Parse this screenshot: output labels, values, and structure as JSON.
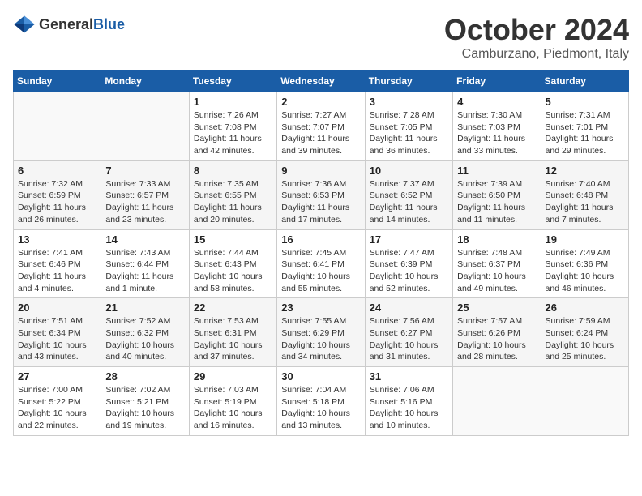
{
  "header": {
    "logo": {
      "general": "General",
      "blue": "Blue"
    },
    "title": "October 2024",
    "location": "Camburzano, Piedmont, Italy"
  },
  "calendar": {
    "days_of_week": [
      "Sunday",
      "Monday",
      "Tuesday",
      "Wednesday",
      "Thursday",
      "Friday",
      "Saturday"
    ],
    "weeks": [
      [
        {
          "day": "",
          "info": ""
        },
        {
          "day": "",
          "info": ""
        },
        {
          "day": "1",
          "info": "Sunrise: 7:26 AM\nSunset: 7:08 PM\nDaylight: 11 hours and 42 minutes."
        },
        {
          "day": "2",
          "info": "Sunrise: 7:27 AM\nSunset: 7:07 PM\nDaylight: 11 hours and 39 minutes."
        },
        {
          "day": "3",
          "info": "Sunrise: 7:28 AM\nSunset: 7:05 PM\nDaylight: 11 hours and 36 minutes."
        },
        {
          "day": "4",
          "info": "Sunrise: 7:30 AM\nSunset: 7:03 PM\nDaylight: 11 hours and 33 minutes."
        },
        {
          "day": "5",
          "info": "Sunrise: 7:31 AM\nSunset: 7:01 PM\nDaylight: 11 hours and 29 minutes."
        }
      ],
      [
        {
          "day": "6",
          "info": "Sunrise: 7:32 AM\nSunset: 6:59 PM\nDaylight: 11 hours and 26 minutes."
        },
        {
          "day": "7",
          "info": "Sunrise: 7:33 AM\nSunset: 6:57 PM\nDaylight: 11 hours and 23 minutes."
        },
        {
          "day": "8",
          "info": "Sunrise: 7:35 AM\nSunset: 6:55 PM\nDaylight: 11 hours and 20 minutes."
        },
        {
          "day": "9",
          "info": "Sunrise: 7:36 AM\nSunset: 6:53 PM\nDaylight: 11 hours and 17 minutes."
        },
        {
          "day": "10",
          "info": "Sunrise: 7:37 AM\nSunset: 6:52 PM\nDaylight: 11 hours and 14 minutes."
        },
        {
          "day": "11",
          "info": "Sunrise: 7:39 AM\nSunset: 6:50 PM\nDaylight: 11 hours and 11 minutes."
        },
        {
          "day": "12",
          "info": "Sunrise: 7:40 AM\nSunset: 6:48 PM\nDaylight: 11 hours and 7 minutes."
        }
      ],
      [
        {
          "day": "13",
          "info": "Sunrise: 7:41 AM\nSunset: 6:46 PM\nDaylight: 11 hours and 4 minutes."
        },
        {
          "day": "14",
          "info": "Sunrise: 7:43 AM\nSunset: 6:44 PM\nDaylight: 11 hours and 1 minute."
        },
        {
          "day": "15",
          "info": "Sunrise: 7:44 AM\nSunset: 6:43 PM\nDaylight: 10 hours and 58 minutes."
        },
        {
          "day": "16",
          "info": "Sunrise: 7:45 AM\nSunset: 6:41 PM\nDaylight: 10 hours and 55 minutes."
        },
        {
          "day": "17",
          "info": "Sunrise: 7:47 AM\nSunset: 6:39 PM\nDaylight: 10 hours and 52 minutes."
        },
        {
          "day": "18",
          "info": "Sunrise: 7:48 AM\nSunset: 6:37 PM\nDaylight: 10 hours and 49 minutes."
        },
        {
          "day": "19",
          "info": "Sunrise: 7:49 AM\nSunset: 6:36 PM\nDaylight: 10 hours and 46 minutes."
        }
      ],
      [
        {
          "day": "20",
          "info": "Sunrise: 7:51 AM\nSunset: 6:34 PM\nDaylight: 10 hours and 43 minutes."
        },
        {
          "day": "21",
          "info": "Sunrise: 7:52 AM\nSunset: 6:32 PM\nDaylight: 10 hours and 40 minutes."
        },
        {
          "day": "22",
          "info": "Sunrise: 7:53 AM\nSunset: 6:31 PM\nDaylight: 10 hours and 37 minutes."
        },
        {
          "day": "23",
          "info": "Sunrise: 7:55 AM\nSunset: 6:29 PM\nDaylight: 10 hours and 34 minutes."
        },
        {
          "day": "24",
          "info": "Sunrise: 7:56 AM\nSunset: 6:27 PM\nDaylight: 10 hours and 31 minutes."
        },
        {
          "day": "25",
          "info": "Sunrise: 7:57 AM\nSunset: 6:26 PM\nDaylight: 10 hours and 28 minutes."
        },
        {
          "day": "26",
          "info": "Sunrise: 7:59 AM\nSunset: 6:24 PM\nDaylight: 10 hours and 25 minutes."
        }
      ],
      [
        {
          "day": "27",
          "info": "Sunrise: 7:00 AM\nSunset: 5:22 PM\nDaylight: 10 hours and 22 minutes."
        },
        {
          "day": "28",
          "info": "Sunrise: 7:02 AM\nSunset: 5:21 PM\nDaylight: 10 hours and 19 minutes."
        },
        {
          "day": "29",
          "info": "Sunrise: 7:03 AM\nSunset: 5:19 PM\nDaylight: 10 hours and 16 minutes."
        },
        {
          "day": "30",
          "info": "Sunrise: 7:04 AM\nSunset: 5:18 PM\nDaylight: 10 hours and 13 minutes."
        },
        {
          "day": "31",
          "info": "Sunrise: 7:06 AM\nSunset: 5:16 PM\nDaylight: 10 hours and 10 minutes."
        },
        {
          "day": "",
          "info": ""
        },
        {
          "day": "",
          "info": ""
        }
      ]
    ]
  }
}
